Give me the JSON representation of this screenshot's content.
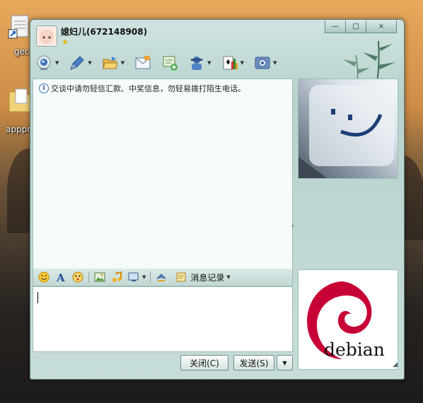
{
  "desktop": {
    "icons": [
      {
        "name": "gec-shortcut",
        "label": "gec"
      },
      {
        "name": "apppro-folder",
        "label": "apppro"
      }
    ]
  },
  "window": {
    "contact_name": "媳妇儿(672148908)",
    "status_icon": "star-icon",
    "controls": {
      "minimize": "—",
      "maximize": "□",
      "close": "×"
    }
  },
  "toolbar": {
    "items": [
      {
        "name": "video-call",
        "icon": "webcam-icon"
      },
      {
        "name": "voice-call",
        "icon": "microphone-icon"
      },
      {
        "name": "send-file",
        "icon": "folder-icon"
      },
      {
        "name": "send-email",
        "icon": "mail-icon"
      },
      {
        "name": "create-group",
        "icon": "add-chat-icon"
      },
      {
        "name": "remote-assist",
        "icon": "user-service-icon"
      },
      {
        "name": "games",
        "icon": "spade-card-icon"
      },
      {
        "name": "settings",
        "icon": "settings-icon"
      }
    ]
  },
  "chat": {
    "notice": "交谈中请勿轻信汇款、中奖信息，勿轻易拨打陌生电话。"
  },
  "input_toolbar": {
    "items": [
      "emoji-icon",
      "font-icon",
      "magic-face-icon",
      "image-icon",
      "music-icon",
      "screenshot-icon",
      "shake-icon"
    ],
    "history_label": "消息记录"
  },
  "input": {
    "value": ""
  },
  "buttons": {
    "close_label": "关闭(C)",
    "send_label": "发送(S)"
  },
  "side": {
    "bottom_photo_text": "debian"
  },
  "colors": {
    "window_bg": "#c7dcd8",
    "debian_red": "#c70036"
  }
}
